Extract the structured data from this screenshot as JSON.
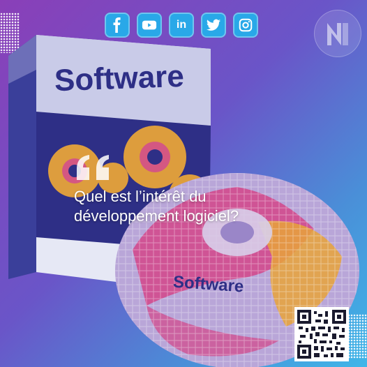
{
  "socials": [
    {
      "icon": "facebook-icon"
    },
    {
      "icon": "youtube-icon"
    },
    {
      "icon": "linkedin-icon",
      "text": "in"
    },
    {
      "icon": "twitter-icon"
    },
    {
      "icon": "instagram-icon"
    }
  ],
  "box": {
    "label": "Software"
  },
  "disc": {
    "label": "Software"
  },
  "headline": {
    "line1": "Quel est l’intérêt du",
    "line2": "développement logiciel?"
  },
  "colors": {
    "accent": "#29a8e8",
    "purple": "#8a3fb8",
    "navy": "#2e2f86",
    "gear": "#e7a33a"
  }
}
